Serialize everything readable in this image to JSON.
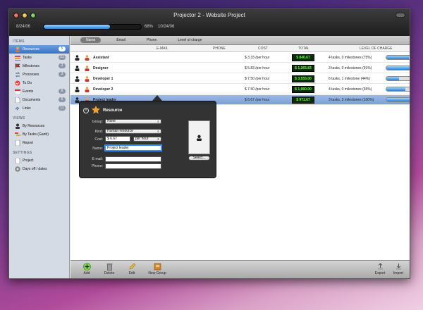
{
  "window": {
    "title": "Projector 2 - Website Project",
    "start_date": "8/24/06",
    "end_date": "10/24/06",
    "progress_percent": 68,
    "progress_label": "68%"
  },
  "sidebar": {
    "sections": [
      {
        "title": "ITEMS",
        "items": [
          {
            "label": "Resources",
            "badge": "5",
            "selected": true
          },
          {
            "label": "Tasks",
            "badge": "21"
          },
          {
            "label": "Milestones",
            "badge": "3"
          },
          {
            "label": "Processes",
            "badge": "3"
          },
          {
            "label": "To Do",
            "badge": ""
          },
          {
            "label": "Events",
            "badge": "6"
          },
          {
            "label": "Documents",
            "badge": "5"
          },
          {
            "label": "Links",
            "badge": "11"
          }
        ]
      },
      {
        "title": "VIEWS",
        "items": [
          {
            "label": "By Resources"
          },
          {
            "label": "By Tasks (Gantt)"
          },
          {
            "label": "Report"
          }
        ]
      },
      {
        "title": "SETTINGS",
        "items": [
          {
            "label": "Project"
          },
          {
            "label": "Days off / dates"
          }
        ]
      }
    ]
  },
  "tabs": [
    "Name",
    "Email",
    "Phone",
    "Level of charge"
  ],
  "columns": {
    "email": "E-MAIL",
    "phone": "PHONE",
    "cost": "COST",
    "total": "TOTAL",
    "charge": "LEVEL OF CHARGE"
  },
  "rows": [
    {
      "name": "Assistant",
      "cost": "$ 3.33 /per hour",
      "total": "$ 846.67",
      "charge": "4 tasks, 0 milestones (75%)",
      "level": 75
    },
    {
      "name": "Designer",
      "cost": "$ 5.83 /per hour",
      "total": "$ 1,265.83",
      "charge": "3 tasks, 0 milestones (91%)",
      "level": 91
    },
    {
      "name": "Developer 1",
      "cost": "$ 7.50 /per hour",
      "total": "$ 3,555.00",
      "charge": "6 tasks, 1 milestone (44%)",
      "level": 44
    },
    {
      "name": "Developer 2",
      "cost": "$ 7.50 /per hour",
      "total": "$ 1,980.00",
      "charge": "4 tasks, 0 milestones (65%)",
      "level": 65
    },
    {
      "name": "Project leader",
      "cost": "$ 6.67 /per hour",
      "total": "$ 971.67",
      "charge": "3 tasks, 3 milestones (100%)",
      "level": 100,
      "selected": true
    }
  ],
  "popover": {
    "title": "Resource",
    "group_label": "Group:",
    "group_value": "None",
    "kind_label": "Kind:",
    "kind_value": "Human resource",
    "cost_label": "Cost:",
    "cost_value": "$ 6.67",
    "cost_unit": "per hour",
    "name_label": "Name:",
    "name_value": "Project leader",
    "email_label": "E-mail:",
    "phone_label": "Phone:",
    "select_label": "Select..."
  },
  "toolbar": {
    "add": "Add",
    "delete": "Delete",
    "edit": "Edit",
    "new_group": "New Group",
    "export": "Export",
    "import": "Import"
  },
  "colors": {
    "accent": "#3b70c4",
    "total_text": "#6bff3a"
  }
}
